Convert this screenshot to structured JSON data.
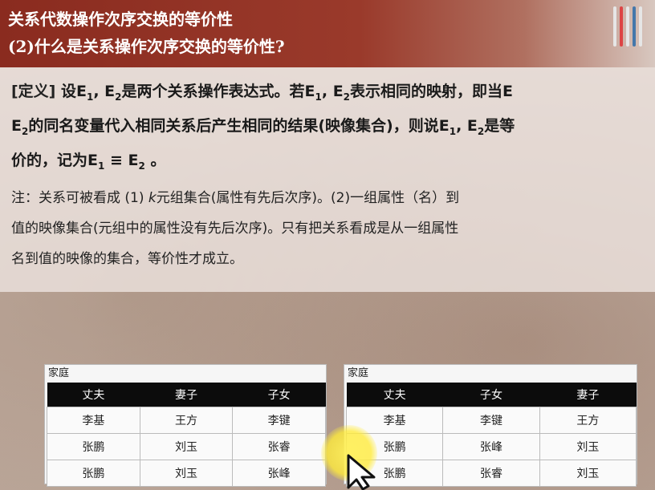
{
  "header": {
    "line1": "关系代数操作次序交换的等价性",
    "line2": "(2)什么是关系操作次序交换的等价性?"
  },
  "definition": {
    "tag": "[定义]",
    "p1a": " 设E",
    "p1b": ", E",
    "p1c": "是两个关系操作表达式。若E",
    "p1d": ", E",
    "p1e": "表示相同的映射，即当E",
    "p2a": "E",
    "p2b": "的同名变量代入相同关系后产生相同的结果(映像集合)，则说E",
    "p2c": ", E",
    "p2d": "是等",
    "p3a": "价的，记为E",
    "p3b": " ≡ E",
    "p3c": " 。",
    "sub1": "1",
    "sub2": "2"
  },
  "note": {
    "l1a": "注：关系可被看成 (1) ",
    "l1k": "k",
    "l1b": "元组集合(属性有先后次序)。(2)一组属性（名）到",
    "l2": "值的映像集合(元组中的属性没有先后次序)。只有把关系看成是从一组属性",
    "l3": "名到值的映像的集合，等价性才成立。"
  },
  "table_left": {
    "title": "家庭",
    "headers": [
      "丈夫",
      "妻子",
      "子女"
    ],
    "rows": [
      [
        "李基",
        "王方",
        "李键"
      ],
      [
        "张鹏",
        "刘玉",
        "张睿"
      ],
      [
        "张鹏",
        "刘玉",
        "张峰"
      ]
    ]
  },
  "table_right": {
    "title": "家庭",
    "headers": [
      "丈夫",
      "子女",
      "妻子"
    ],
    "rows": [
      [
        "李基",
        "李键",
        "王方"
      ],
      [
        "张鹏",
        "张峰",
        "刘玉"
      ],
      [
        "张鹏",
        "张睿",
        "刘玉"
      ]
    ]
  },
  "colors": {
    "header_bg": "#8a2b1f",
    "table_header_bg": "#0c0c0c",
    "highlight": "#ffeb3c"
  }
}
